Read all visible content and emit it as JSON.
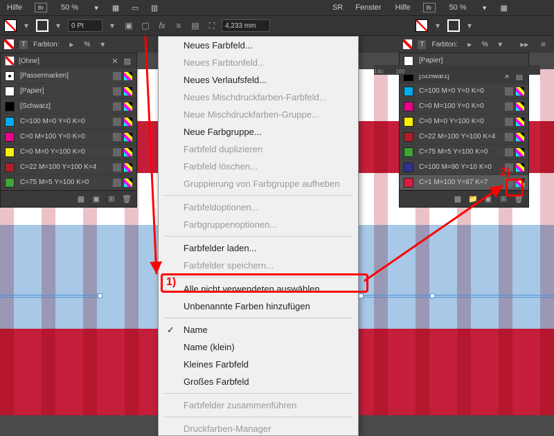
{
  "menubar": {
    "help": "Hilfe",
    "bridge": "Br",
    "zoom": "50 %",
    "sr": "SR",
    "window": "Fenster"
  },
  "optbar": {
    "stroke_pt": "0 Pt",
    "width_mm": "4,233 mm",
    "tint_label": "Farbton:",
    "tint_pct": "%"
  },
  "swatches_left": {
    "header": "[Ohne]",
    "rows": [
      {
        "name": "[Passermarken]",
        "color": "#fff",
        "reg": true
      },
      {
        "name": "[Papier]",
        "color": "#ffffff"
      },
      {
        "name": "[Schwarz]",
        "color": "#000000"
      },
      {
        "name": "C=100 M=0 Y=0 K=0",
        "color": "#00aeef"
      },
      {
        "name": "C=0 M=100 Y=0 K=0",
        "color": "#ec008c"
      },
      {
        "name": "C=0 M=0 Y=100 K=0",
        "color": "#fff200"
      },
      {
        "name": "C=22 M=100 Y=100 K=4",
        "color": "#b01e2e"
      },
      {
        "name": "C=75 M=5 Y=100 K=0",
        "color": "#3fa535"
      }
    ]
  },
  "swatches_right": {
    "header_papier": "[Papier]",
    "header_schwarz": "[Schwarz]",
    "rows": [
      {
        "name": "C=100 M=0 Y=0 K=0",
        "color": "#00aeef"
      },
      {
        "name": "C=0 M=100 Y=0 K=0",
        "color": "#ec008c"
      },
      {
        "name": "C=0 M=0 Y=100 K=0",
        "color": "#fff200"
      },
      {
        "name": "C=22 M=100 Y=100 K=4",
        "color": "#b01e2e"
      },
      {
        "name": "C=75 M=5 Y=100 K=0",
        "color": "#3fa535"
      },
      {
        "name": "C=100 M=90 Y=10 K=0",
        "color": "#2e3192"
      },
      {
        "name": "C=1 M=100 Y=87 K=7",
        "color": "#d81e3e"
      }
    ]
  },
  "ctx": {
    "new_color": "Neues Farbfeld...",
    "new_tint": "Neues Farbtonfeld...",
    "new_gradient": "Neues Verlaufsfeld...",
    "new_mixed": "Neues Mischdruckfarben-Farbfeld...",
    "new_mixed_group": "Neue Mischdruckfarben-Gruppe...",
    "new_group": "Neue Farbgruppe...",
    "dup": "Farbfeld duplizieren",
    "del": "Farbfeld löschen...",
    "ungroup": "Gruppierung von Farbgruppe aufheben",
    "opts": "Farbfeldoptionen...",
    "group_opts": "Farbgruppenoptionen...",
    "load": "Farbfelder laden...",
    "save": "Farbfelder speichern...",
    "sel_unused": "Alle nicht verwendeten auswählen",
    "add_unnamed": "Unbenannte Farben hinzufügen",
    "name": "Name",
    "name_small": "Name (klein)",
    "small_swatch": "Kleines Farbfeld",
    "big_swatch": "Großes Farbfeld",
    "merge": "Farbfelder zusammenführen",
    "print_mgr": "Druckfarben-Manager"
  },
  "anno": {
    "step1": "1)",
    "step2": "2)"
  },
  "ruler": [
    "140",
    "160"
  ]
}
